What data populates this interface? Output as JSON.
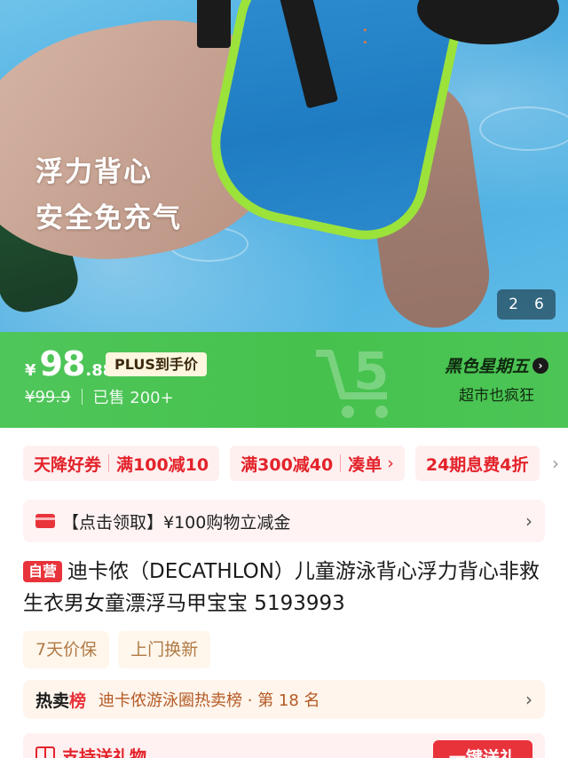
{
  "hero": {
    "overlay_line1": "浮力背心",
    "overlay_line2": "安全免充气",
    "pager_current": "2",
    "pager_total": "6"
  },
  "price": {
    "currency": "¥",
    "integer": "98",
    "decimal": ".88",
    "plus_tag": "PLUS到手价",
    "original": "¥99.9",
    "sold": "已售 200+"
  },
  "promo": {
    "title": "黑色星期五",
    "subtitle": "超市也疯狂",
    "logo_number": "5"
  },
  "coupons": [
    {
      "part1": "天降好券",
      "part2": "满100减10"
    },
    {
      "part1": "满300减40",
      "part2": "凑单"
    },
    {
      "part1": "24期息费4折"
    }
  ],
  "voucher": {
    "text": "【点击领取】¥100购物立减金"
  },
  "product": {
    "badge": "自营",
    "title": "迪卡侬（DECATHLON）儿童游泳背心浮力背心非救生衣男女童漂浮马甲宝宝 5193993"
  },
  "services": [
    "7天价保",
    "上门换新"
  ],
  "ranking": {
    "label_part1": "热卖",
    "label_part2": "榜",
    "text": "迪卡侬游泳圈热卖榜 · 第 18 名"
  },
  "gift": {
    "text": "支持送礼物",
    "button": "一键送礼"
  },
  "colors": {
    "price_band": "#46c14d",
    "accent_red": "#e8333b",
    "chip_bg": "#fff0f0"
  }
}
